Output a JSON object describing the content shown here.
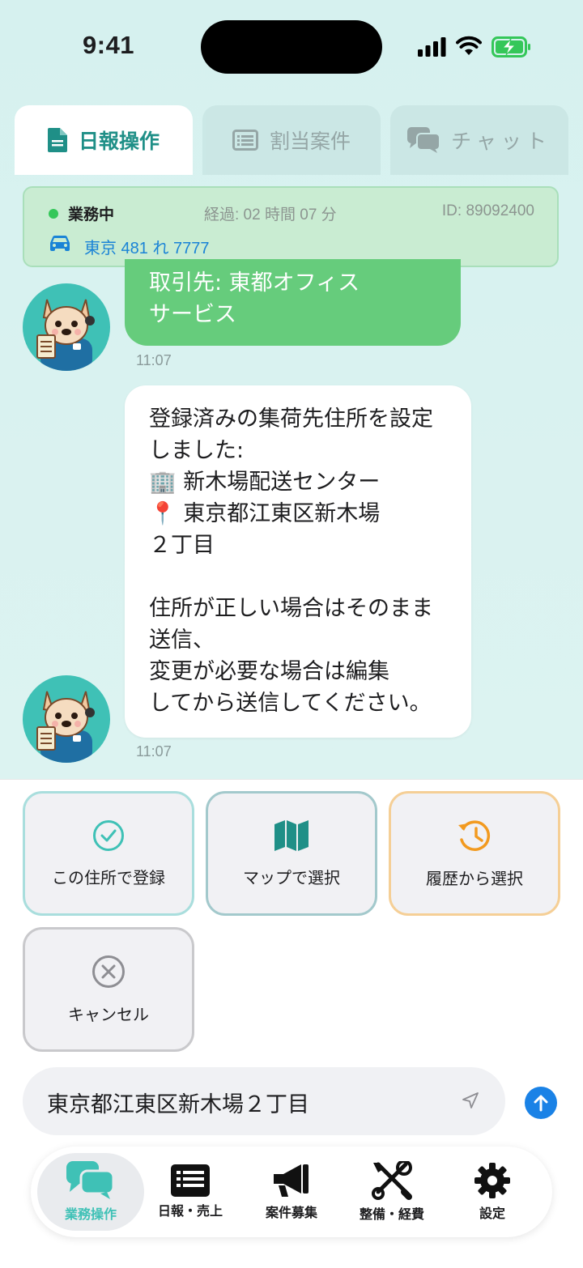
{
  "status_bar": {
    "time": "9:41"
  },
  "tabs": [
    {
      "label": "日報操作",
      "icon": "document-icon",
      "active": true
    },
    {
      "label": "割当案件",
      "icon": "list-icon",
      "active": false
    },
    {
      "label": "チャット",
      "icon": "chat-icon",
      "active": false
    }
  ],
  "status_card": {
    "state": "業務中",
    "elapsed": "経過: 02 時間 07 分",
    "id": "ID: 89092400",
    "plate": "東京 481 れ 7777",
    "state_color": "#34c759"
  },
  "messages": [
    {
      "lines": [
        "取引先: 東都オフィス",
        "サービス"
      ],
      "time": "11:07",
      "bubble_color": "#66cc7c"
    },
    {
      "lines": [
        "登録済みの集荷先住所を設定",
        "しました:",
        "🏢 新木場配送センター",
        "📍 東京都江東区新木場",
        "２丁目",
        "",
        "住所が正しい場合はそのまま",
        "送信、",
        "変更が必要な場合は編集",
        "してから送信してください。"
      ],
      "time": "11:07"
    }
  ],
  "quick_actions": [
    {
      "label": "この住所で登録",
      "icon": "check-circle-icon"
    },
    {
      "label": "マップで選択",
      "icon": "map-icon"
    },
    {
      "label": "履歴から選択",
      "icon": "history-icon"
    },
    {
      "label": "キャンセル",
      "icon": "x-circle-icon"
    }
  ],
  "input": {
    "value": "東京都江東区新木場２丁目"
  },
  "bottom_nav": [
    {
      "label": "業務操作",
      "icon": "chat-bubbles-icon",
      "active": true
    },
    {
      "label": "日報・売上",
      "icon": "report-list-icon",
      "active": false
    },
    {
      "label": "案件募集",
      "icon": "megaphone-icon",
      "active": false
    },
    {
      "label": "整備・経費",
      "icon": "tools-icon",
      "active": false
    },
    {
      "label": "設定",
      "icon": "gear-icon",
      "active": false
    }
  ],
  "colors": {
    "accent": "#1f8f87",
    "teal": "#3fc1b6",
    "link_blue": "#1a83d6",
    "send_blue": "#1a82e6"
  }
}
